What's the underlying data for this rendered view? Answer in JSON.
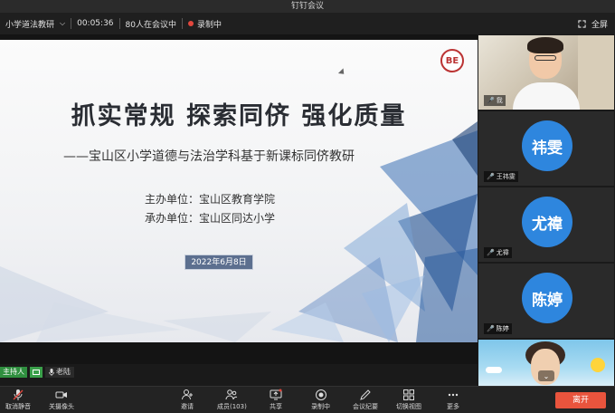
{
  "window": {
    "title": "钉钉会议"
  },
  "infobar": {
    "meeting_name": "小学道法教研",
    "duration": "00:05:36",
    "participants_in_meeting": "80人在会议中",
    "recording": "录制中",
    "fullscreen_label": "全屏"
  },
  "slide": {
    "title": "抓实常规  探索同侪  强化质量",
    "subtitle": "——宝山区小学道德与法治学科基于新课标同侪教研",
    "org_host": "主办单位：宝山区教育学院",
    "org_organizer": "承办单位：宝山区同达小学",
    "date": "2022年6月8日",
    "logo_text": "BE"
  },
  "host_bar": {
    "badge": "主持人",
    "name": "老陆"
  },
  "participants": [
    {
      "label": "我",
      "avatar": ""
    },
    {
      "label": "王祎雯",
      "avatar": "祎雯"
    },
    {
      "label": "尤禕",
      "avatar": "尤禕"
    },
    {
      "label": "陈婷",
      "avatar": "陈婷"
    }
  ],
  "toolbar": {
    "mute": "取消静音",
    "camera": "关摄像头",
    "invite": "邀请",
    "members": "成员(103)",
    "share": "共享",
    "recording": "录制中",
    "minutes": "会议纪要",
    "switch_view": "切换视图",
    "more": "更多",
    "leave": "离开"
  },
  "colors": {
    "leave": "#e9543d",
    "avatar": "#2e86de",
    "recording_dot": "#e2473d",
    "host_badge": "#2f8f3f"
  }
}
